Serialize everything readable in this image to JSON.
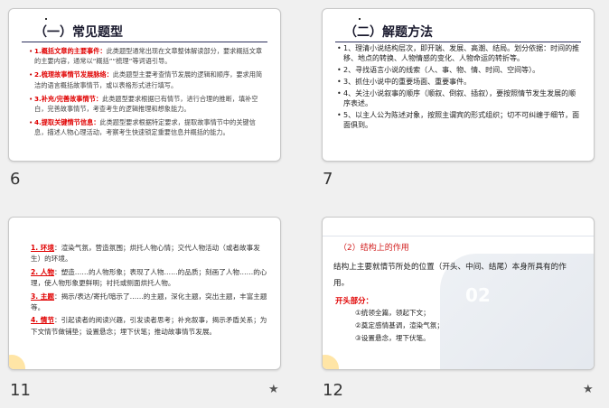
{
  "slides": [
    {
      "number": "6",
      "title": "（一）常见题型",
      "items": [
        {
          "bullet": "•",
          "key": "1.概括文章的主要事件：",
          "text": "此类题型通常出现在文章整体解读部分，要求概括文章的主要内容，通常以“概括”“梳理”等词语引导。"
        },
        {
          "bullet": "•",
          "key": "2.梳理故事情节发展脉络：",
          "text": "此类题型主要考查情节发展的逻辑和顺序，要求用简洁的语言概括故事情节，或以表格形式进行填写。"
        },
        {
          "bullet": "•",
          "key": "3.补充/完善故事情节：",
          "text": "此类题型要求根据已有情节，进行合理的推断，填补空白，完善故事情节，考查考生的逻辑推理和想象能力。"
        },
        {
          "bullet": "•",
          "key": "4.提取关键情节信息：",
          "text": "此类题型要求根据特定要求，提取故事情节中的关键信息，描述人物心理活动，考察考生快速锁定重要信息并概括的能力。"
        }
      ]
    },
    {
      "number": "7",
      "title": "（二）解题方法",
      "items": [
        {
          "bullet": "•",
          "text": "1、理清小说结构层次，即开端、发展、高潮、结局。划分依据：时间的推移、地点的转换、人物情感的变化、人物命运的转折等。"
        },
        {
          "bullet": "•",
          "text": "2、寻找语言小说的线索（人、事、物、情、时间、空间等）。"
        },
        {
          "bullet": "•",
          "text": "3、抓住小说中的重要场面、重要事件。"
        },
        {
          "bullet": "•",
          "text": "4、关注小说叙事的顺序（顺叙、倒叙、插叙），要按照情节发生发展的顺序表述。"
        },
        {
          "bullet": "•",
          "text": "5、以主人公为陈述对象，按照主谓宾的形式组织；切不可纠缠于细节，面面俱到。"
        }
      ]
    },
    {
      "number": "11",
      "star": "★",
      "items": [
        {
          "key": "1. 环境",
          "text": "：渲染气氛，营造氛围；烘托人物心情；交代人物活动（或者故事发生）的环境。"
        },
        {
          "key": "2. 人物",
          "text": "：塑造……的人物形象；表现了人物……的品质；刻画了人物……的心理，使人物形象更鲜明；衬托或侧面烘托人物。"
        },
        {
          "key": "3. 主题",
          "text": "：揭示/表达/寄托/暗示了……的主题，深化主题，突出主题，丰富主题等。"
        },
        {
          "key": "4. 情节",
          "text": "：引起读者的阅读兴趣，引发读者思考；补充叙事，揭示矛盾关系；为下文情节做铺垫；设置悬念；埋下伏笔；推动故事情节发展。"
        }
      ]
    },
    {
      "number": "12",
      "star": "★",
      "subtitle": "（2）结构上的作用",
      "paragraph": "结构上主要就情节所处的位置（开头、中间、结尾）本身所具有的作用。",
      "label": "开头部分：",
      "watermark": "02",
      "list": [
        "①统领全篇，领起下文；",
        "②奠定感情基调，渲染气氛；",
        "③设置悬念，埋下伏笔。"
      ]
    }
  ]
}
